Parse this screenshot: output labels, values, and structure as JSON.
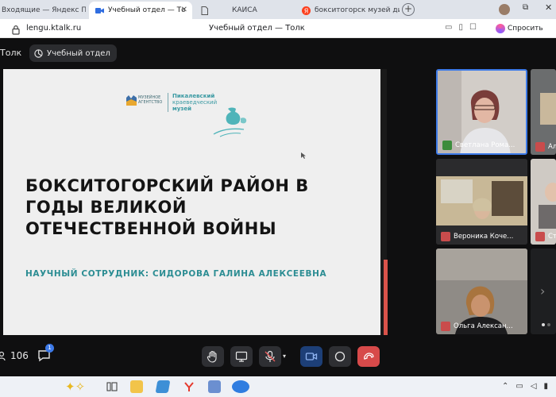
{
  "browser": {
    "tabs": [
      {
        "title": "Входящие — Яндекс Почт",
        "icon": "mail-icon",
        "active": false
      },
      {
        "title": "Учебный отдел — То",
        "icon": "video-icon",
        "active": true
      },
      {
        "title": "",
        "icon": "document-icon",
        "active": false
      },
      {
        "title": "КАИСА",
        "icon": "",
        "active": false
      },
      {
        "title": "бокситогорск музей дир",
        "icon": "yandex-icon",
        "active": false
      }
    ],
    "url": "lengu.ktalk.ru",
    "page_title": "Учебный отдел — Толк",
    "ask_label": "Спросить"
  },
  "app": {
    "name": "Толк",
    "room": "Учебный отдел"
  },
  "slide": {
    "logo_small": "МУЗЕЙНОЕ АГЕНТСТВО",
    "logo_line1": "Пикалевский",
    "logo_line2": "краеведческий",
    "logo_line3": "музей",
    "heading_line1": "БОКСИТОГОРСКИЙ РАЙОН В",
    "heading_line2": "ГОДЫ ВЕЛИКОЙ",
    "heading_line3": "ОТЕЧЕСТВЕННОЙ ВОЙНЫ",
    "subtitle": "НАУЧНЫЙ СОТРУДНИК:  СИДОРОВА ГАЛИНА АЛЕКСЕЕВНА"
  },
  "participants": [
    {
      "name": "Светлана Рома...",
      "mic": "on",
      "active": true
    },
    {
      "name": "Ал",
      "mic": "off"
    },
    {
      "name": "Вероника Коче...",
      "mic": "off"
    },
    {
      "name": "Ст",
      "mic": "off"
    },
    {
      "name": "Ольга Алексан...",
      "mic": "off"
    }
  ],
  "controls": {
    "participant_count": "106",
    "chat_unread": "1"
  },
  "colors": {
    "accent": "#3d7ae8",
    "slide_subtitle": "#2c8d93",
    "hangup": "#d74a4a",
    "mic_off": "#c94c4c"
  }
}
